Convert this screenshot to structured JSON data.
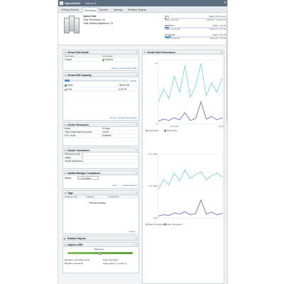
{
  "header": {
    "title": "VplexSSAN",
    "actions_label": "Actions ▾",
    "close_glyph": "✕",
    "tabs": [
      {
        "label": "Getting Started"
      },
      {
        "label": "Summary"
      },
      {
        "label": "Monitor"
      },
      {
        "label": "Manage"
      },
      {
        "label": "Related Objects"
      }
    ]
  },
  "summary": {
    "cluster_name": "Vplexr SAN",
    "lines": [
      {
        "label": "Total Processors:",
        "value": "64"
      },
      {
        "label": "Total vMotion Migrations:",
        "value": "31"
      }
    ],
    "resources": [
      {
        "label": "CPU",
        "free": "FREE: 215.26 GHz",
        "used": "USED: 3.45 GHz",
        "capacity": "CAPACITY: 217.86 GHz",
        "fill": 0.02
      },
      {
        "label": "MEMORY",
        "free": "FREE: 1.75 TB",
        "used": "USED: 134.57 GB",
        "capacity": "CAPACITY: 1.87 TB",
        "fill": 0.07
      },
      {
        "label": "STORAGE",
        "free": "FREE: 6.34 TB",
        "used": "USED: 740.00 GB",
        "capacity": "CAPACITY: 7.05 TB",
        "fill": 0.1
      }
    ]
  },
  "panels": {
    "health": {
      "title": "Virtual SAN Health",
      "col1": "Test Name",
      "col2": "Test Result",
      "row_name": "Cluster",
      "row_result": "Passed",
      "link": "Monitor Virtual SAN Health"
    },
    "capacity": {
      "title": "Virtual SAN Capacity",
      "percent": "7.33 %",
      "used_label": "Used",
      "used_value": "748.80 GB",
      "free_label": "Free",
      "free_value": "6.34 TB",
      "link": "Monitor Virtual SAN capacity"
    },
    "cluster_resources": {
      "title": "Cluster Resources",
      "rows": [
        {
          "label": "Hosts",
          "value": "8 Hosts"
        },
        {
          "label": "Total virtual flash resources",
          "value": "0.00 B"
        },
        {
          "label": "EVC mode",
          "value": "Disabled"
        }
      ]
    },
    "consumers": {
      "title": "Cluster Consumers",
      "rows": [
        {
          "label": "Resource pools",
          "value": "0"
        },
        {
          "label": "vApps",
          "value": "0"
        },
        {
          "label": "Virtual machines",
          "value": "5"
        }
      ]
    },
    "update_manager": {
      "title": "Update Manager Compliance",
      "status_label": "Status",
      "status_value": "Compliant",
      "scan_link": "Scan",
      "detail_link": "Detailed Status"
    },
    "tags": {
      "title": "Tags",
      "col1": "Assigned Tag",
      "col2": "Category",
      "col3": "Description",
      "empty": "This list is empty.",
      "link": "Assign..."
    },
    "related": {
      "title": "Related Objects"
    },
    "drs": {
      "title": "vSphere DRS",
      "balanced": "Balanced",
      "lines": [
        {
          "label": "Migration automation level:",
          "value": "Fully automated"
        },
        {
          "label": "Migration threshold:",
          "value": "Apply priority 1, priority 2..."
        }
      ]
    },
    "performance": {
      "title": "Virtual SAN Performance"
    }
  },
  "colors": {
    "read_series": "#7fd3e8",
    "write_series": "#8d86c9",
    "accent_blue": "#4a8fcf",
    "ok_green": "#6aa84f"
  },
  "chart_data": [
    {
      "type": "line",
      "title": "",
      "x": [
        "11:30 AM",
        "11:45 AM",
        "12:00 PM",
        "12:15 PM",
        "12:30 PM",
        "12:45 PM",
        "1:00 PM",
        "1:15 PM",
        "1:30 PM",
        "1:45 PM",
        "2:00 PM",
        "2:15 PM",
        "2:30 PM"
      ],
      "xticks": [
        "12:15 PM",
        "2:30 PM"
      ],
      "yticks": [
        "0",
        "3.5"
      ],
      "ylim": [
        0,
        100
      ],
      "legend": "bottom-left",
      "series": [
        {
          "name": "Read IOPS",
          "values": [
            35,
            55,
            40,
            75,
            50,
            92,
            42,
            60,
            95,
            45,
            65,
            50,
            72
          ]
        },
        {
          "name": "Write IOPS",
          "values": [
            5,
            8,
            6,
            10,
            7,
            18,
            6,
            9,
            35,
            8,
            12,
            7,
            10
          ]
        }
      ]
    },
    {
      "type": "line",
      "title": "",
      "x": [
        "11:30 AM",
        "11:45 AM",
        "12:00 PM",
        "12:15 PM",
        "12:30 PM",
        "12:45 PM",
        "1:00 PM",
        "1:15 PM",
        "1:30 PM",
        "1:45 PM",
        "2:00 PM",
        "2:15 PM",
        "2:30 PM"
      ],
      "yticks": [
        "11.47 MB/s",
        "3.47 MB/s",
        "0 B/s"
      ],
      "ylim": [
        0,
        100
      ],
      "legend": "bottom-left",
      "series": [
        {
          "name": "Read Throughput",
          "values": [
            45,
            60,
            52,
            70,
            58,
            75,
            62,
            68,
            72,
            60,
            66,
            70,
            64
          ]
        },
        {
          "name": "Write Throughput",
          "values": [
            3,
            5,
            4,
            8,
            6,
            10,
            5,
            7,
            28,
            6,
            9,
            5,
            7
          ]
        }
      ]
    }
  ]
}
